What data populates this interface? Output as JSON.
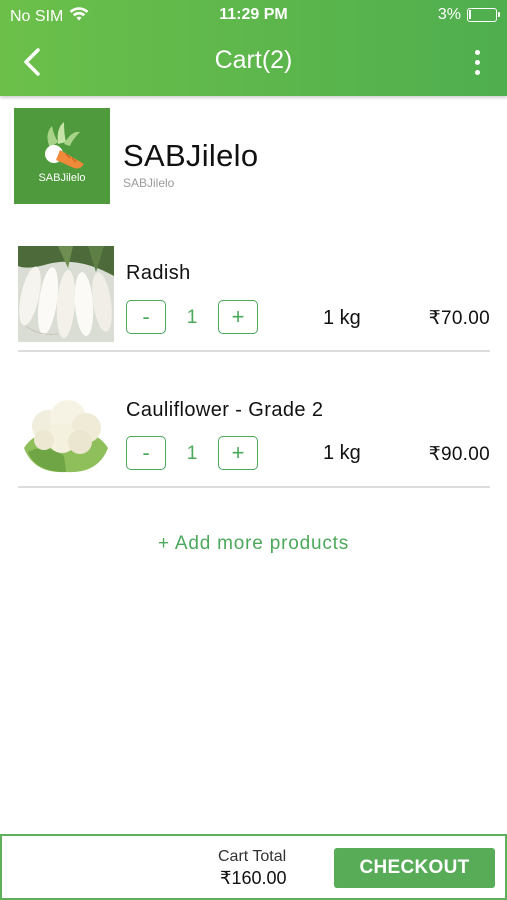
{
  "status_bar": {
    "carrier": "No SIM",
    "time": "11:29 PM",
    "battery": "3%"
  },
  "nav": {
    "title": "Cart(2)",
    "back_icon": "chevron-left-icon",
    "more_icon": "more-vertical-icon"
  },
  "store": {
    "name": "SABJilelo",
    "subtitle": "SABJilelo",
    "logo_text": "SABJilelo"
  },
  "cart": {
    "items": [
      {
        "name": "Radish",
        "quantity": "1",
        "unit": "1 kg",
        "price": "₹70.00",
        "minus_label": "-",
        "plus_label": "+"
      },
      {
        "name": "Cauliflower - Grade 2",
        "quantity": "1",
        "unit": "1 kg",
        "price": "₹90.00",
        "minus_label": "-",
        "plus_label": "+"
      }
    ],
    "add_more_label": "+ Add more products"
  },
  "footer": {
    "total_label": "Cart Total",
    "total_value": "₹160.00",
    "checkout_label": "CHECKOUT"
  },
  "colors": {
    "brand_green": "#58ac58",
    "header_gradient_start": "#6cc04a",
    "header_gradient_end": "#4fae4e"
  }
}
